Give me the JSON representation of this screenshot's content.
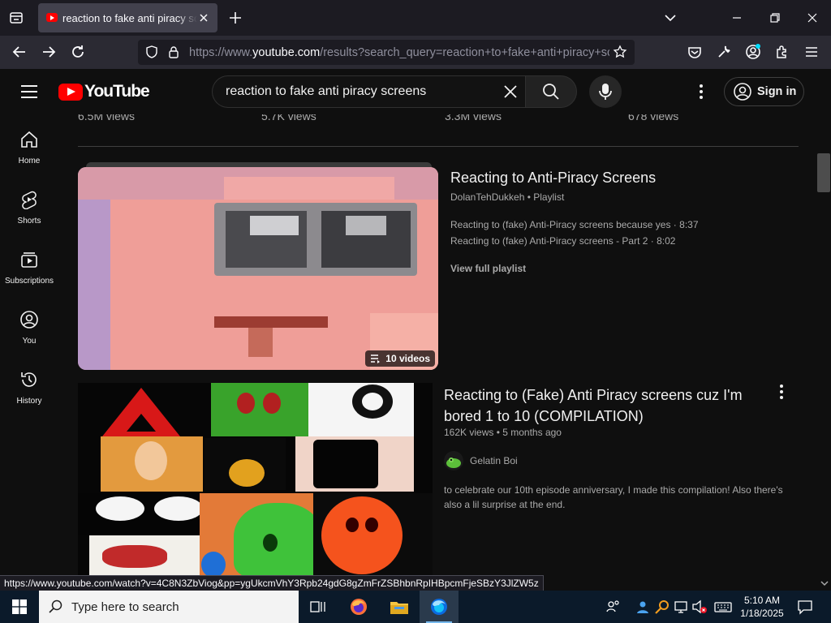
{
  "browser": {
    "tab_title": "reaction to fake anti piracy screens - YouTube",
    "url_prefix": "https://www.",
    "url_domain": "youtube.com",
    "url_rest": "/results?search_query=reaction+to+fake+anti+piracy+screens",
    "status_url": "https://www.youtube.com/watch?v=4C8N3ZbViog&pp=ygUkcmVhY3Rpb24gdG8gZmFrZSBhbnRpIHBpcmFjeSBzY3JlZW5z"
  },
  "header": {
    "logo_text": "YouTube",
    "search_query": "reaction to fake anti piracy screens",
    "sign_in_label": "Sign in"
  },
  "guide": {
    "items": [
      {
        "label": "Home",
        "icon": "home-icon"
      },
      {
        "label": "Shorts",
        "icon": "shorts-icon"
      },
      {
        "label": "Subscriptions",
        "icon": "subscriptions-icon"
      },
      {
        "label": "You",
        "icon": "you-icon"
      },
      {
        "label": "History",
        "icon": "history-icon"
      }
    ]
  },
  "above_row": {
    "views": [
      "6.5M views",
      "5.7K views",
      "3.3M views",
      "678 views"
    ]
  },
  "playlist": {
    "title": "Reacting to Anti-Piracy Screens",
    "channel": "DolanTehDukkeh",
    "type": "Playlist",
    "video_count": "10 videos",
    "videos": [
      {
        "title": "Reacting to (fake) Anti-Piracy screens because yes",
        "duration": "8:37"
      },
      {
        "title": "Reacting to (fake) Anti-Piracy screens - Part 2",
        "duration": "8:02"
      }
    ],
    "view_all_label": "View full playlist"
  },
  "video": {
    "title": "Reacting to (Fake) Anti Piracy screens cuz I'm bored 1 to 10 (COMPILATION)",
    "views": "162K views",
    "age": "5 months ago",
    "channel": "Gelatin Boi",
    "description": "to celebrate our 10th episode anniversary, I made this compilation! Also there's also a lil surprise at the end."
  },
  "taskbar": {
    "search_placeholder": "Type here to search",
    "time": "5:10 AM",
    "date": "1/18/2025"
  },
  "colors": {
    "yt_red": "#ff0000",
    "background": "#0f0f0f",
    "text_primary": "#f1f1f1",
    "text_secondary": "#aaaaaa"
  }
}
